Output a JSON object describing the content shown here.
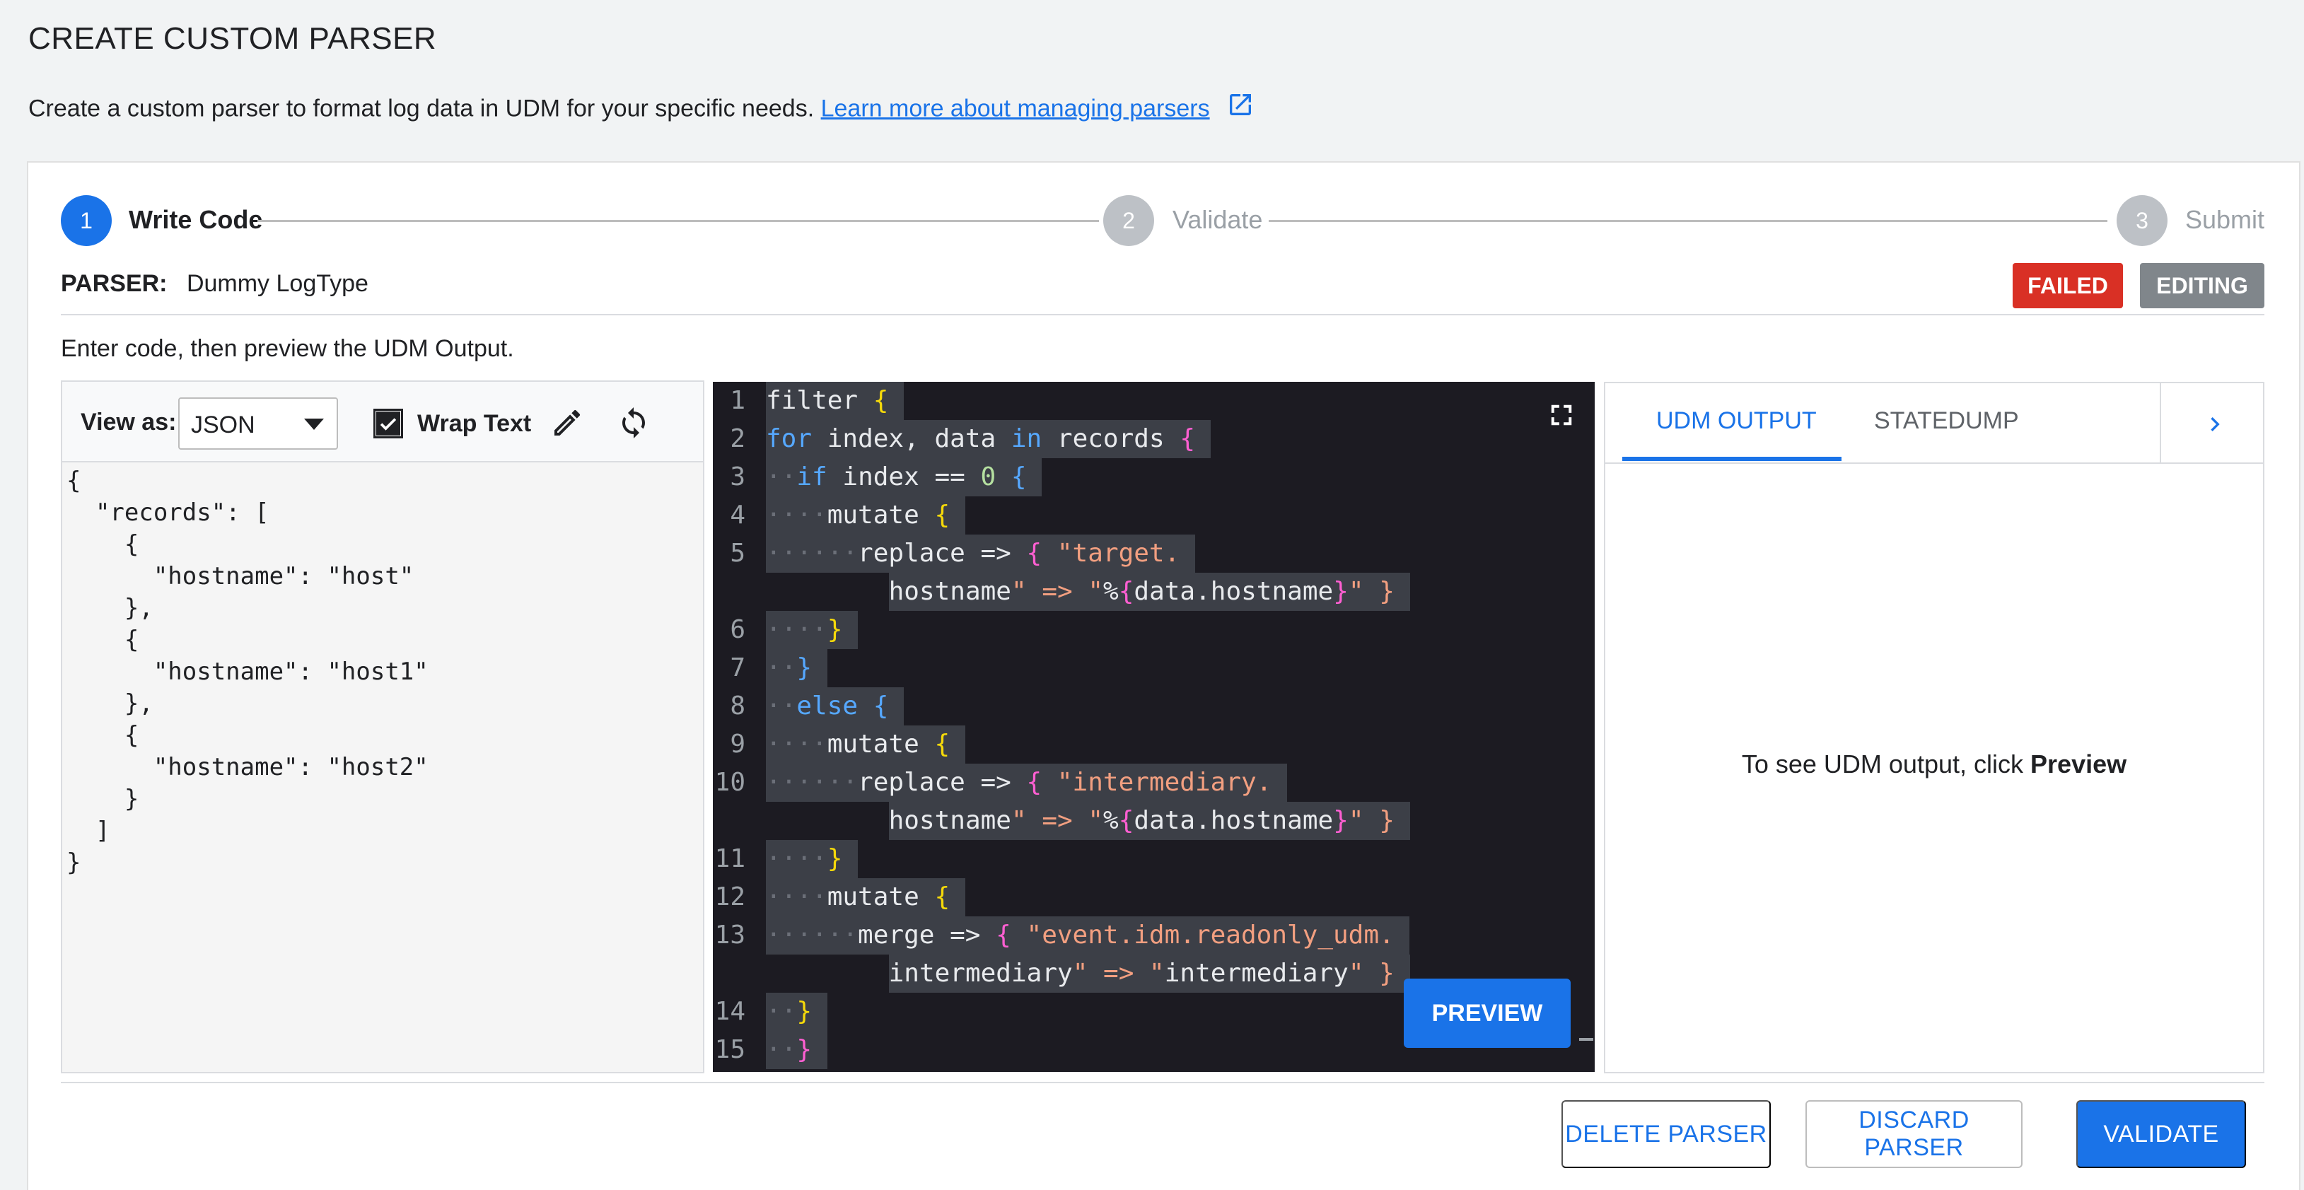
{
  "header": {
    "title": "CREATE CUSTOM PARSER",
    "description": "Create a custom parser to format log data in UDM for your specific needs.",
    "learn_more_link": "Learn more about managing parsers"
  },
  "stepper": {
    "steps": [
      {
        "number": "1",
        "label": "Write Code",
        "state": "active"
      },
      {
        "number": "2",
        "label": "Validate",
        "state": "inactive"
      },
      {
        "number": "3",
        "label": "Submit",
        "state": "inactive"
      }
    ]
  },
  "parser": {
    "label": "PARSER:",
    "name": "Dummy LogType",
    "status_failed": "FAILED",
    "status_editing": "EDITING"
  },
  "instructions": "Enter code, then preview the UDM Output.",
  "input_panel": {
    "view_as_label": "View as:",
    "view_as_value": "JSON",
    "wrap_text_label": "Wrap Text",
    "wrap_text_checked": true,
    "json_lines": [
      "{",
      "  \"records\": [",
      "    {",
      "      \"hostname\": \"host\"",
      "    },",
      "    {",
      "      \"hostname\": \"host1\"",
      "    },",
      "    {",
      "      \"hostname\": \"host2\"",
      "    }",
      "  ]",
      "}"
    ]
  },
  "code_editor": {
    "preview_button": "PREVIEW",
    "lines": [
      {
        "n": "1",
        "text": "filter {"
      },
      {
        "n": "2",
        "text": "for index, data in records {"
      },
      {
        "n": "3",
        "text": "  if index == 0 {"
      },
      {
        "n": "4",
        "text": "    mutate {"
      },
      {
        "n": "5",
        "text": "      replace => { \"target.hostname\" => \"%{data.hostname}\" }"
      },
      {
        "n": "6",
        "text": "    }"
      },
      {
        "n": "7",
        "text": "  }"
      },
      {
        "n": "8",
        "text": "  else {"
      },
      {
        "n": "9",
        "text": "    mutate {"
      },
      {
        "n": "10",
        "text": "      replace => { \"intermediary.hostname\" => \"%{data.hostname}\" }"
      },
      {
        "n": "11",
        "text": "    }"
      },
      {
        "n": "12",
        "text": "    mutate {"
      },
      {
        "n": "13",
        "text": "      merge => { \"event.idm.readonly_udm.intermediary\" => \"intermediary\" }"
      },
      {
        "n": "14",
        "text": "  }"
      },
      {
        "n": "15",
        "text": "  }"
      }
    ]
  },
  "output_panel": {
    "tab_udm": "UDM OUTPUT",
    "tab_statedump": "STATEDUMP",
    "message_prefix": "To see UDM output, click",
    "message_action": "Preview"
  },
  "footer": {
    "delete_label": "DELETE PARSER",
    "discard_label": "DISCARD PARSER",
    "validate_label": "VALIDATE"
  },
  "colors": {
    "accent": "#1a73e8",
    "failed": "#d93025",
    "editing": "#80868b",
    "editor_bg": "#1c1b22"
  }
}
